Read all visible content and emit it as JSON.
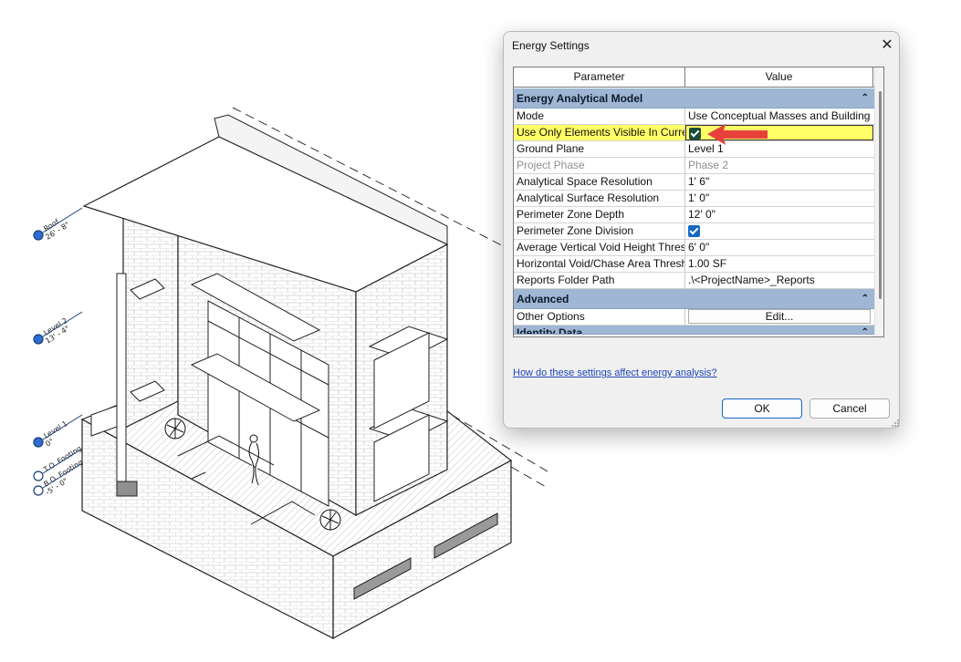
{
  "dialog": {
    "title": "Energy Settings",
    "close_glyph": "✕",
    "columns": {
      "parameter": "Parameter",
      "value": "Value"
    },
    "groups": [
      {
        "label": "Energy Analytical Model",
        "rows": [
          {
            "param": "Mode",
            "value": "Use Conceptual Masses and Building"
          },
          {
            "param": "Use Only Elements Visible In Curre",
            "value_checkbox": true
          },
          {
            "param": "Ground Plane",
            "value": "Level 1"
          },
          {
            "param": "Project Phase",
            "value": "Phase 2"
          },
          {
            "param": "Analytical Space Resolution",
            "value": "1'  6\""
          },
          {
            "param": "Analytical Surface Resolution",
            "value": "1'  0\""
          },
          {
            "param": "Perimeter Zone Depth",
            "value": "12'  0\""
          },
          {
            "param": "Perimeter Zone Division",
            "value_checkbox": true
          },
          {
            "param": "Average Vertical Void Height Thres",
            "value": "6'  0\""
          },
          {
            "param": "Horizontal Void/Chase Area Thresh",
            "value": "1.00 SF"
          },
          {
            "param": "Reports Folder Path",
            "value": ".\\<ProjectName>_Reports"
          }
        ]
      },
      {
        "label": "Advanced",
        "rows": [
          {
            "param": "Other Options",
            "value_button": "Edit..."
          }
        ]
      },
      {
        "label": "Identity Data"
      }
    ],
    "collapse_glyph": "⌃",
    "help_link": "How do these settings affect energy analysis?",
    "ok_label": "OK",
    "cancel_label": "Cancel"
  },
  "drawing": {
    "level_markers": [
      {
        "name": "Roof",
        "elev": "26' - 8\""
      },
      {
        "name": "Level 2",
        "elev": "13' - 4\""
      },
      {
        "name": "Level 1",
        "elev": "0\""
      },
      {
        "name": "T.O. Footing",
        "elev": ""
      },
      {
        "name": "B.O. Footing",
        "elev": "-5' - 0\""
      }
    ]
  },
  "colors": {
    "group_header": "#9fb6d4",
    "highlight": "#ffff66",
    "checkbox_blue": "#1667c4",
    "arrow_red": "#e8413c",
    "link": "#1f48b8"
  }
}
